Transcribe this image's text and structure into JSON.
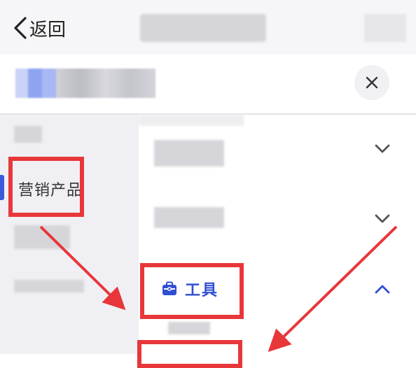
{
  "header": {
    "back_label": "返回",
    "back_icon": "chevron-left-icon"
  },
  "search": {
    "close_icon": "close-icon"
  },
  "sidebar": {
    "active_item_label": "营销产品"
  },
  "content": {
    "row1_icon": "chevron-down-icon",
    "row2_icon": "chevron-down-icon",
    "tools_label": "工具",
    "tools_icon": "toolbox-icon",
    "tools_toggle_icon": "chevron-up-icon"
  },
  "colors": {
    "accent": "#2f4fd3",
    "annotation": "#e8373a"
  }
}
